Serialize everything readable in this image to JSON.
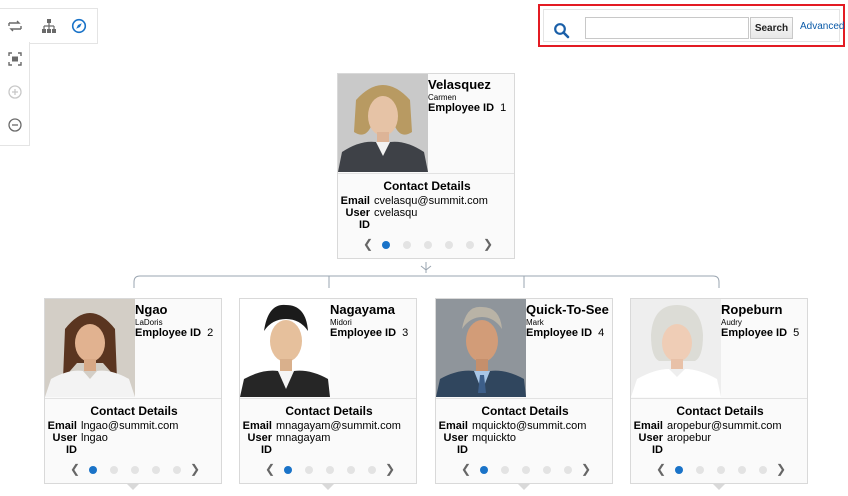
{
  "search": {
    "placeholder": "",
    "value": "",
    "button_label": "Search",
    "advanced_label": "Advanced"
  },
  "toolbar": {
    "icons": [
      "change-layout-icon",
      "hierarchy-icon",
      "compass-icon"
    ],
    "side_icons": [
      "zoom-fit-icon",
      "zoom-in-icon",
      "zoom-out-icon"
    ]
  },
  "colors": {
    "accent": "#1a73c8",
    "highlight": "#e31b23",
    "link": "#0a5aa8"
  },
  "labels": {
    "employee_id": "Employee ID",
    "contact_details": "Contact Details",
    "email": "Email",
    "user_id": "User ID"
  },
  "employees": [
    {
      "last_name": "Velasquez",
      "first_name": "Carmen",
      "employee_id": "1",
      "email": "cvelasqu@summit.com",
      "user_id": "cvelasqu"
    },
    {
      "last_name": "Ngao",
      "first_name": "LaDoris",
      "employee_id": "2",
      "email": "lngao@summit.com",
      "user_id": "lngao"
    },
    {
      "last_name": "Nagayama",
      "first_name": "Midori",
      "employee_id": "3",
      "email": "mnagayam@summit.com",
      "user_id": "mnagayam"
    },
    {
      "last_name": "Quick-To-See",
      "first_name": "Mark",
      "employee_id": "4",
      "email": "mquickto@summit.com",
      "user_id": "mquickto"
    },
    {
      "last_name": "Ropeburn",
      "first_name": "Audry",
      "employee_id": "5",
      "email": "aropebur@summit.com",
      "user_id": "aropebur"
    }
  ],
  "pager": {
    "pages": 5,
    "active_page": 1
  }
}
